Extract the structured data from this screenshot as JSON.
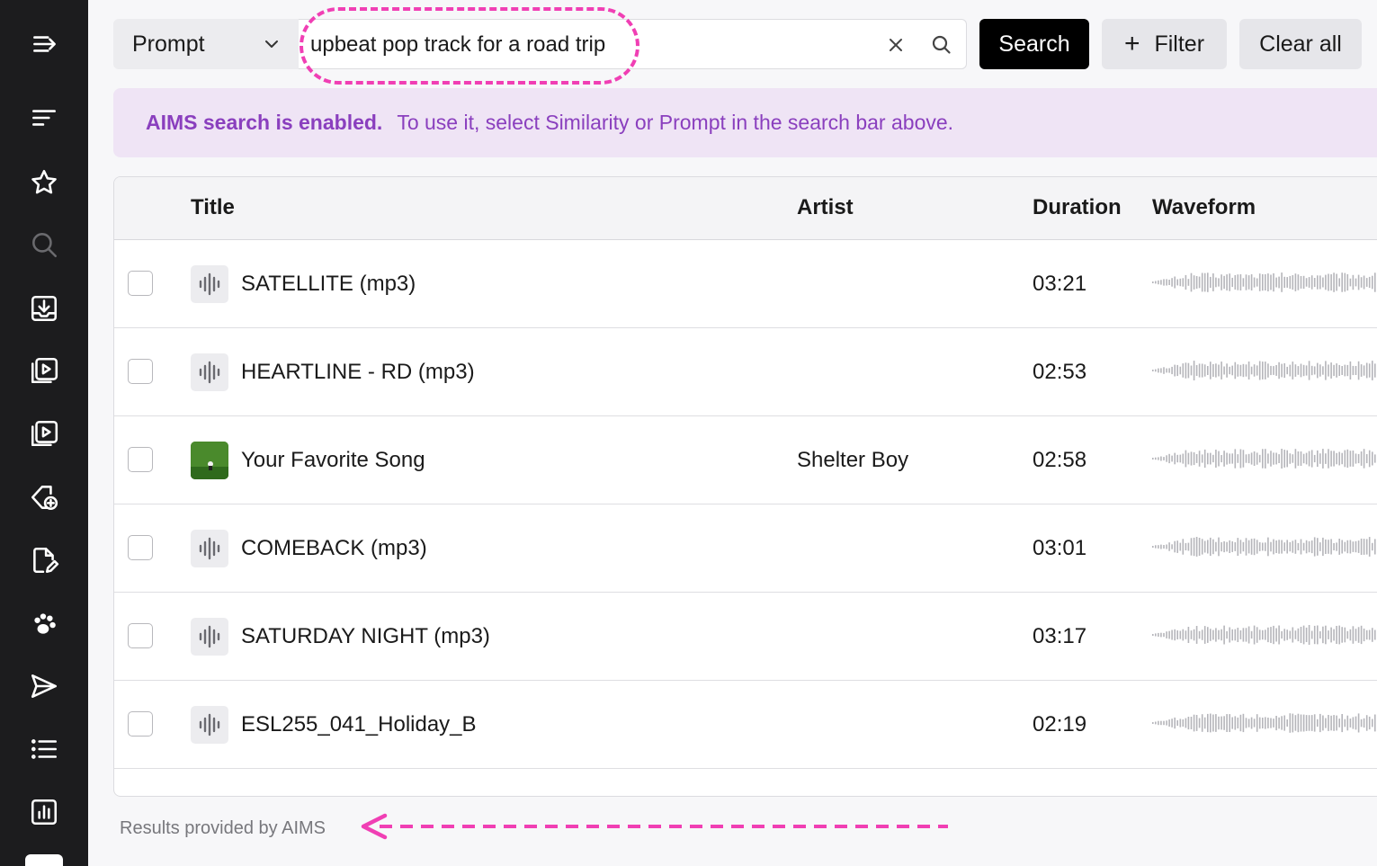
{
  "sidebar": {
    "items": [
      {
        "icon": "collapse-menu-icon"
      },
      {
        "icon": "list-lines-icon"
      },
      {
        "icon": "star-icon"
      },
      {
        "icon": "search-icon"
      },
      {
        "icon": "download-tray-icon"
      },
      {
        "icon": "playlist-play-icon"
      },
      {
        "icon": "video-library-icon"
      },
      {
        "icon": "tag-add-icon"
      },
      {
        "icon": "document-edit-icon"
      },
      {
        "icon": "paw-icon"
      },
      {
        "icon": "send-icon"
      },
      {
        "icon": "bulleted-list-icon"
      },
      {
        "icon": "bar-chart-icon"
      }
    ]
  },
  "search": {
    "mode": "Prompt",
    "query": "upbeat pop track for a road trip",
    "search_label": "Search",
    "filter_label": "Filter",
    "clear_label": "Clear all"
  },
  "banner": {
    "strong": "AIMS search is enabled.",
    "text": "To use it, select Similarity or Prompt in the search bar above."
  },
  "table": {
    "columns": {
      "title": "Title",
      "artist": "Artist",
      "duration": "Duration",
      "waveform": "Waveform"
    },
    "rows": [
      {
        "title": "SATELLITE (mp3)",
        "artist": "",
        "duration": "03:21",
        "thumb": "audio"
      },
      {
        "title": "HEARTLINE - RD (mp3)",
        "artist": "",
        "duration": "02:53",
        "thumb": "audio"
      },
      {
        "title": "Your Favorite Song",
        "artist": "Shelter Boy",
        "duration": "02:58",
        "thumb": "cover"
      },
      {
        "title": "COMEBACK (mp3)",
        "artist": "",
        "duration": "03:01",
        "thumb": "audio"
      },
      {
        "title": "SATURDAY NIGHT (mp3)",
        "artist": "",
        "duration": "03:17",
        "thumb": "audio"
      },
      {
        "title": "ESL255_041_Holiday_B",
        "artist": "",
        "duration": "02:19",
        "thumb": "audio"
      }
    ]
  },
  "footer": {
    "note": "Results provided by AIMS"
  },
  "colors": {
    "accent_annotation": "#f03fb4",
    "banner_text": "#8a3fbe",
    "banner_bg": "#efe4f5",
    "sidebar_bg": "#1c1c1e"
  }
}
